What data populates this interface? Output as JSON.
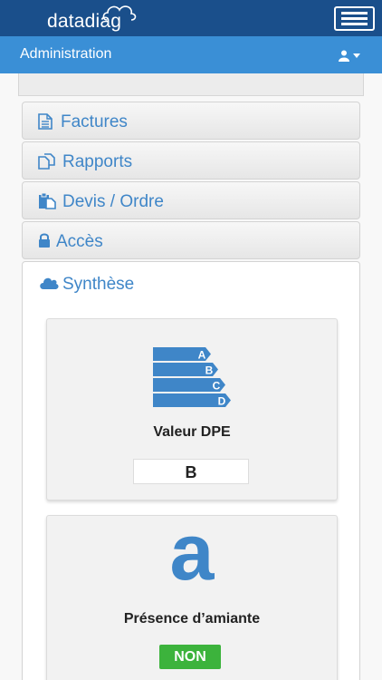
{
  "app": {
    "logo_text": "datadiag"
  },
  "header": {
    "title": "Administration"
  },
  "sections": [
    {
      "label": "Factures",
      "icon": "file-text-icon"
    },
    {
      "label": "Rapports",
      "icon": "copy-icon"
    },
    {
      "label": "Devis / Ordre",
      "icon": "clipboard-icon"
    },
    {
      "label": "Accès",
      "icon": "lock-icon"
    },
    {
      "label": "Synthèse",
      "icon": "cloud-icon"
    }
  ],
  "synthese": {
    "dpe": {
      "title": "Valeur DPE",
      "value": "B",
      "scale_letters": [
        "A",
        "B",
        "C",
        "D"
      ]
    },
    "amiante": {
      "letter": "a",
      "title": "Présence d’amiante",
      "value": "NON"
    }
  },
  "colors": {
    "navbar": "#1a4f8b",
    "subbar": "#3a8fd6",
    "link": "#3f86c8",
    "badge_green": "#3cb33c"
  }
}
